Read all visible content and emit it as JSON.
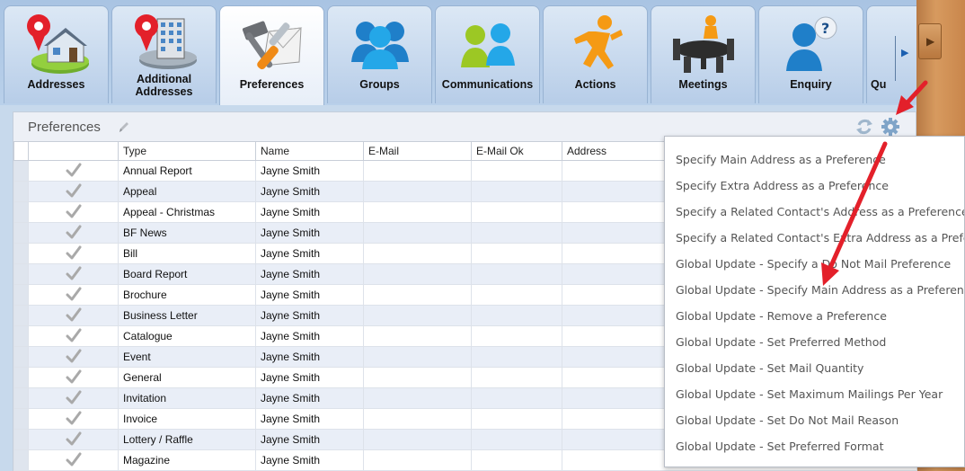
{
  "tabs": [
    {
      "label": "Addresses",
      "icon": "house-pin-icon"
    },
    {
      "label": "Additional Addresses",
      "icon": "building-pin-icon"
    },
    {
      "label": "Preferences",
      "icon": "tools-icon",
      "active": true
    },
    {
      "label": "Groups",
      "icon": "group-people-icon"
    },
    {
      "label": "Communications",
      "icon": "communication-people-icon"
    },
    {
      "label": "Actions",
      "icon": "running-man-icon"
    },
    {
      "label": "Meetings",
      "icon": "meeting-table-icon"
    },
    {
      "label": "Enquiry",
      "icon": "person-question-icon"
    },
    {
      "label": "Qu",
      "icon": "partial-tab-icon"
    }
  ],
  "panel": {
    "title": "Preferences"
  },
  "grid": {
    "columns": [
      "Type",
      "Name",
      "E-Mail",
      "E-Mail Ok",
      "Address"
    ],
    "rows": [
      {
        "type": "Annual Report",
        "name": "Jayne Smith"
      },
      {
        "type": "Appeal",
        "name": "Jayne Smith"
      },
      {
        "type": "Appeal - Christmas",
        "name": "Jayne Smith"
      },
      {
        "type": "BF News",
        "name": "Jayne Smith"
      },
      {
        "type": "Bill",
        "name": "Jayne Smith"
      },
      {
        "type": "Board Report",
        "name": "Jayne Smith"
      },
      {
        "type": "Brochure",
        "name": "Jayne Smith"
      },
      {
        "type": "Business Letter",
        "name": "Jayne Smith"
      },
      {
        "type": "Catalogue",
        "name": "Jayne Smith"
      },
      {
        "type": "Event",
        "name": "Jayne Smith"
      },
      {
        "type": "General",
        "name": "Jayne Smith"
      },
      {
        "type": "Invitation",
        "name": "Jayne Smith"
      },
      {
        "type": "Invoice",
        "name": "Jayne Smith"
      },
      {
        "type": "Lottery / Raffle",
        "name": "Jayne Smith"
      },
      {
        "type": "Magazine",
        "name": "Jayne Smith"
      }
    ]
  },
  "menu": {
    "items": [
      "Specify Main Address as a Preference",
      "Specify Extra Address as a Preference",
      "Specify a Related Contact's Address as a Preference",
      "Specify a Related Contact's Extra Address as a Preference",
      "Global Update - Specify a Do Not Mail Preference",
      "Global Update - Specify Main Address as a Preference",
      "Global Update - Remove a Preference",
      "Global Update - Set Preferred Method",
      "Global Update - Set Mail Quantity",
      "Global Update - Set Maximum Mailings Per Year",
      "Global Update - Set Do Not Mail Reason",
      "Global Update - Set Preferred Format"
    ]
  },
  "colors": {
    "annotation_arrow": "#e3202a",
    "accent_blue": "#1b5fb0",
    "checkmark": "#a9a9a9"
  }
}
